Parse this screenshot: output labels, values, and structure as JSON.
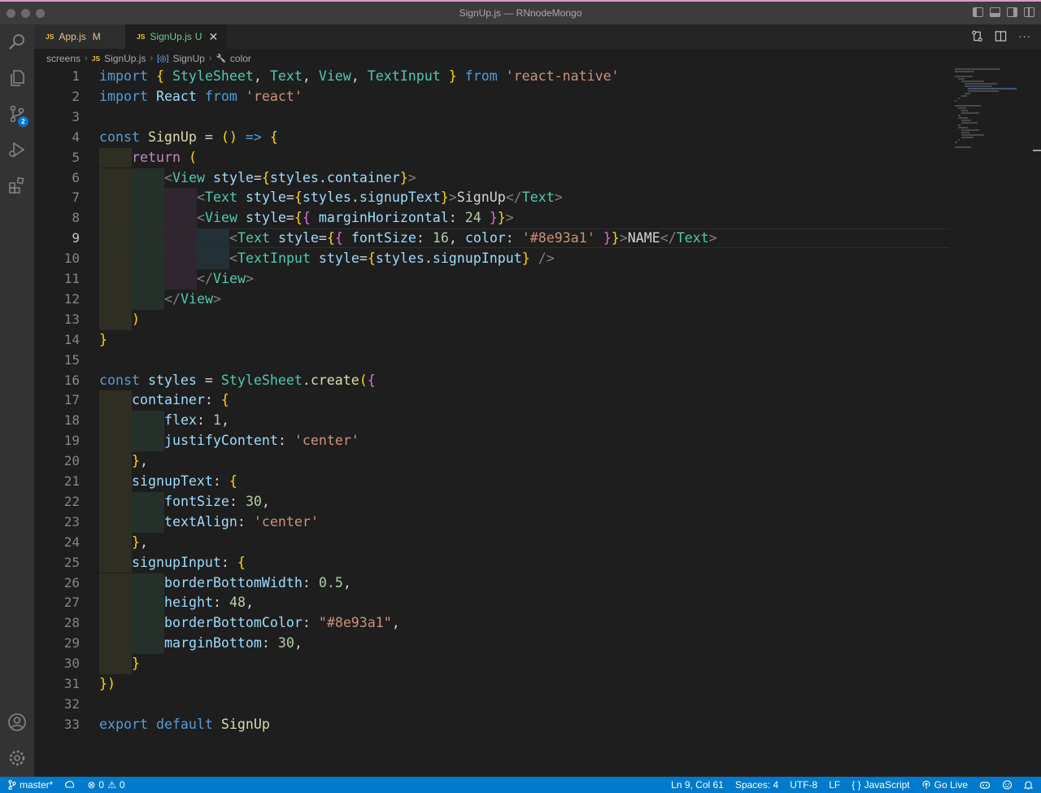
{
  "window": {
    "title": "SignUp.js — RNnodeMongo"
  },
  "tabs": [
    {
      "icon": "JS",
      "label": "App.js",
      "status": "M"
    },
    {
      "icon": "JS",
      "label": "SignUp.js",
      "status": "U",
      "close": "✕"
    }
  ],
  "breadcrumb": [
    {
      "label": "screens"
    },
    {
      "icon": "JS",
      "label": "SignUp.js"
    },
    {
      "icon": "[◎]",
      "label": "SignUp"
    },
    {
      "icon": "🔧",
      "label": "color"
    }
  ],
  "editor": {
    "language": "JavaScript",
    "current_line": "9",
    "line_numbers": [
      "1",
      "2",
      "3",
      "4",
      "5",
      "6",
      "7",
      "8",
      "9",
      "10",
      "11",
      "12",
      "13",
      "14",
      "15",
      "16",
      "17",
      "18",
      "19",
      "20",
      "21",
      "22",
      "23",
      "24",
      "25",
      "26",
      "27",
      "28",
      "29",
      "30",
      "31",
      "32",
      "33"
    ],
    "code_lines": [
      "import { StyleSheet, Text, View, TextInput } from 'react-native'",
      "import React from 'react'",
      "",
      "const SignUp = () => {",
      "    return (",
      "        <View style={styles.container}>",
      "            <Text style={styles.signupText}>SignUp</Text>",
      "            <View style={{ marginHorizontal: 24 }}>",
      "                <Text style={{ fontSize: 16, color: '#8e93a1' }}>NAME</Text>",
      "                <TextInput style={styles.signupInput} />",
      "            </View>",
      "        </View>",
      "    )",
      "}",
      "",
      "const styles = StyleSheet.create({",
      "    container: {",
      "        flex: 1,",
      "        justifyContent: 'center'",
      "    },",
      "    signupText: {",
      "        fontSize: 30,",
      "        textAlign: 'center'",
      "    },",
      "    signupInput: {",
      "        borderBottomWidth: 0.5,",
      "        height: 48,",
      "        borderBottomColor: \"#8e93a1\",",
      "        marginBottom: 30,",
      "    }",
      "})",
      "",
      "export default SignUp"
    ]
  },
  "activity_bar": {
    "items": [
      "search-icon",
      "explorer-icon",
      "source-control-icon",
      "run-debug-icon",
      "extensions-icon"
    ],
    "source_control_badge": "2",
    "bottom": [
      "account-icon",
      "settings-gear-icon"
    ]
  },
  "status_bar": {
    "branch": "master*",
    "errors": "0",
    "warnings": "0",
    "cursor": "Ln 9, Col 61",
    "spaces": "Spaces: 4",
    "encoding": "UTF-8",
    "eol": "LF",
    "language": "JavaScript",
    "golive": "Go Live"
  },
  "colors": {
    "status_bar": "#007acc",
    "editor_bg": "#1e1e1e",
    "keyword": "#569cd6",
    "control": "#c586c0",
    "string": "#ce9178",
    "tag": "#4ec9b0"
  }
}
